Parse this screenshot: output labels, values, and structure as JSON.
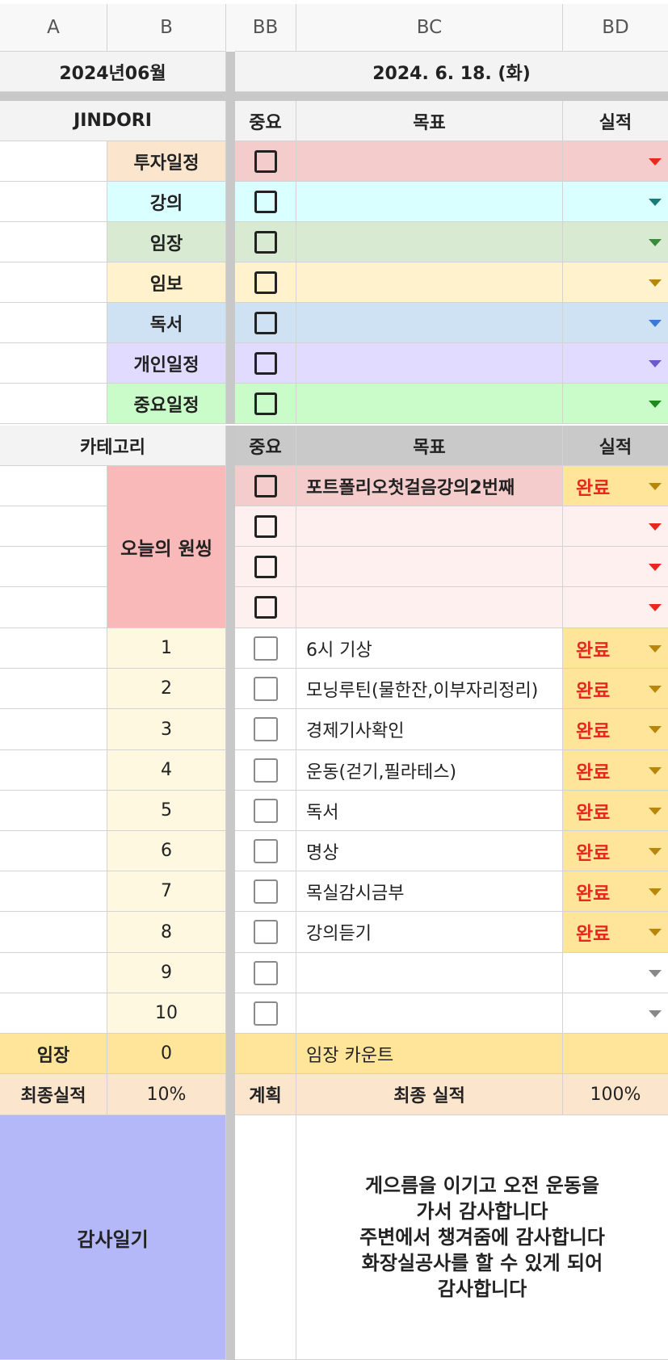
{
  "columns": {
    "a": "A",
    "b": "B",
    "bb": "BB",
    "bc": "BC",
    "bd": "BD"
  },
  "month_label": "2024년06월",
  "date_label": "2024. 6. 18. (화)",
  "schedule_header": {
    "name": "JINDORI",
    "important": "중요",
    "goal": "목표",
    "result": "실적"
  },
  "schedule_rows": [
    {
      "label": "투자일정",
      "label_bg": "#fce5cd",
      "row_bg": "#f4cccc",
      "arrow": "#e8281e"
    },
    {
      "label": "강의",
      "label_bg": "#d9ffff",
      "row_bg": "#d9ffff",
      "arrow": "#1a7a7a"
    },
    {
      "label": "임장",
      "label_bg": "#d9ead3",
      "row_bg": "#d9ead3",
      "arrow": "#3a8a3a"
    },
    {
      "label": "임보",
      "label_bg": "#fff2cc",
      "row_bg": "#fff2cc",
      "arrow": "#b8860b"
    },
    {
      "label": "독서",
      "label_bg": "#cfe2f3",
      "row_bg": "#cfe2f3",
      "arrow": "#3c78d8"
    },
    {
      "label": "개인일정",
      "label_bg": "#e1dcff",
      "row_bg": "#e1dcff",
      "arrow": "#6a5acd"
    },
    {
      "label": "중요일정",
      "label_bg": "#c9fcc9",
      "row_bg": "#c9fcc9",
      "arrow": "#1e8a1e"
    }
  ],
  "task_header": {
    "category": "카테고리",
    "important": "중요",
    "goal": "목표",
    "result": "실적"
  },
  "one_thing": {
    "label": "오늘의 원씽",
    "rows": [
      {
        "goal": "포트폴리오첫걸음강의2번째",
        "status": "완료"
      },
      {
        "goal": "",
        "status": ""
      },
      {
        "goal": "",
        "status": ""
      },
      {
        "goal": "",
        "status": ""
      }
    ]
  },
  "tasks": [
    {
      "num": "1",
      "goal": "6시 기상",
      "status": "완료"
    },
    {
      "num": "2",
      "goal": "모닝루틴(물한잔,이부자리정리)",
      "status": "완료"
    },
    {
      "num": "3",
      "goal": "경제기사확인",
      "status": "완료"
    },
    {
      "num": "4",
      "goal": "운동(걷기,필라테스)",
      "status": "완료"
    },
    {
      "num": "5",
      "goal": "독서",
      "status": "완료"
    },
    {
      "num": "6",
      "goal": "명상",
      "status": "완료"
    },
    {
      "num": "7",
      "goal": "목실감시금부",
      "status": "완료"
    },
    {
      "num": "8",
      "goal": "강의듣기",
      "status": "완료"
    },
    {
      "num": "9",
      "goal": "",
      "status": ""
    },
    {
      "num": "10",
      "goal": "",
      "status": ""
    }
  ],
  "imjang": {
    "label": "임장",
    "count": "0",
    "count_label": "임장 카운트"
  },
  "final": {
    "label": "최종실적",
    "percent": "10%",
    "plan": "계획",
    "result_label": "최종 실적",
    "result_percent": "100%"
  },
  "gratitude": {
    "label": "감사일기",
    "lines": [
      "게으름을 이기고 오전 운동을",
      "가서 감사합니다",
      "주변에서 챙겨줌에 감사합니다",
      "화장실공사를 할 수 있게 되어",
      "감사합니다"
    ]
  },
  "colors": {
    "header_bg": "#f3f3f3",
    "one_thing_bg": "#f9b9b9",
    "one_thing_row_bg": "#fff0f0",
    "task_num_bg": "#fff8e1",
    "status_bg": "#ffe599",
    "imjang_bg": "#ffe599",
    "final_bg": "#fce5cd",
    "gratitude_bg": "#b4b8f8",
    "task_header_bg": "#c9c9c9"
  }
}
